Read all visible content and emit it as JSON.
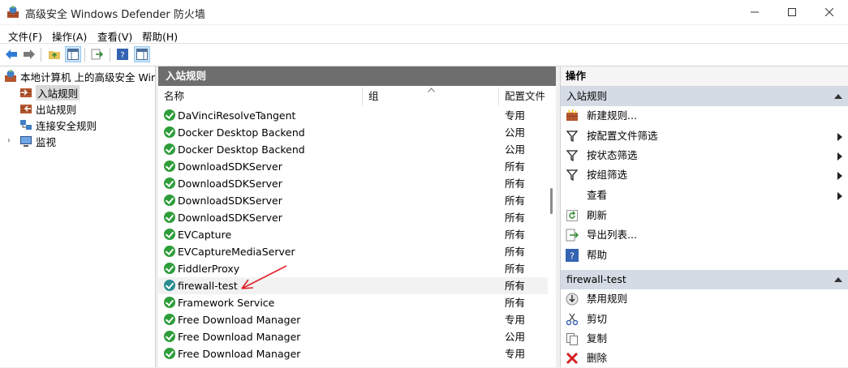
{
  "window": {
    "title": "高级安全 Windows Defender 防火墙"
  },
  "menu": [
    "文件(F)",
    "操作(A)",
    "查看(V)",
    "帮助(H)"
  ],
  "tree": {
    "root": "本地计算机 上的高级安全 Windows Defender 防火墙",
    "items": [
      "入站规则",
      "出站规则",
      "连接安全规则",
      "监视"
    ]
  },
  "middle": {
    "header": "入站规则",
    "columns": {
      "name": "名称",
      "group": "组",
      "profile": "配置文件"
    },
    "rows": [
      {
        "name": "DaVinciResolveTangent",
        "profile": "专用"
      },
      {
        "name": "Docker Desktop Backend",
        "profile": "公用"
      },
      {
        "name": "Docker Desktop Backend",
        "profile": "公用"
      },
      {
        "name": "DownloadSDKServer",
        "profile": "所有"
      },
      {
        "name": "DownloadSDKServer",
        "profile": "所有"
      },
      {
        "name": "DownloadSDKServer",
        "profile": "所有"
      },
      {
        "name": "DownloadSDKServer",
        "profile": "所有"
      },
      {
        "name": "EVCapture",
        "profile": "所有"
      },
      {
        "name": "EVCaptureMediaServer",
        "profile": "所有"
      },
      {
        "name": "FiddlerProxy",
        "profile": "所有"
      },
      {
        "name": "firewall-test",
        "profile": "所有"
      },
      {
        "name": "Framework Service",
        "profile": "所有"
      },
      {
        "name": "Free Download Manager",
        "profile": "专用"
      },
      {
        "name": "Free Download Manager",
        "profile": "公用"
      },
      {
        "name": "Free Download Manager",
        "profile": "专用"
      }
    ]
  },
  "actions": {
    "title": "操作",
    "section1": {
      "title": "入站规则",
      "items": [
        "新建规则...",
        "按配置文件筛选",
        "按状态筛选",
        "按组筛选",
        "查看",
        "刷新",
        "导出列表...",
        "帮助"
      ]
    },
    "section2": {
      "title": "firewall-test",
      "items": [
        "禁用规则",
        "剪切",
        "复制",
        "删除"
      ]
    }
  },
  "colors": {
    "accent": "#d4dbe5",
    "header_gray": "#6e6e6e",
    "annotation_red": "#e0202a"
  }
}
